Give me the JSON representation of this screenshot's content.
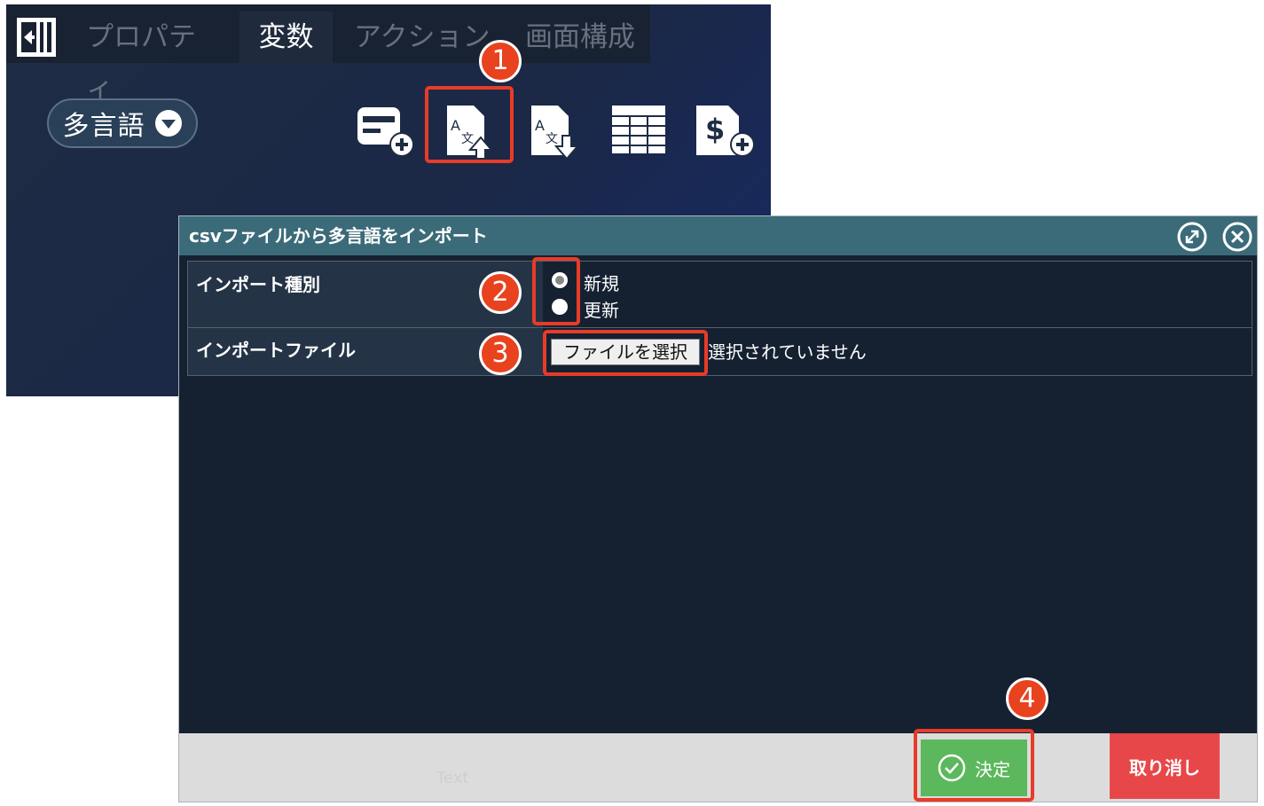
{
  "editor": {
    "tabs": [
      {
        "label": "プロパティ"
      },
      {
        "label": "変数"
      },
      {
        "label": "アクション"
      },
      {
        "label": "画面構成"
      }
    ],
    "language_dropdown_label": "多言語",
    "toolbar_icons": [
      "add-variable-icon",
      "import-language-icon",
      "export-language-icon",
      "table-icon",
      "add-currency-icon"
    ]
  },
  "dialog": {
    "title": "csvファイルから多言語をインポート",
    "import_type": {
      "label": "インポート種別",
      "options": [
        {
          "label": "新規",
          "selected": true
        },
        {
          "label": "更新",
          "selected": false
        }
      ]
    },
    "import_file": {
      "label": "インポートファイル",
      "button_label": "ファイルを選択",
      "status": "選択されていません"
    },
    "confirm_label": "決定",
    "cancel_label": "取り消し",
    "background_text": "Text"
  },
  "annotations": [
    "1",
    "2",
    "3",
    "4"
  ],
  "colors": {
    "title_bar": "#3b6b78",
    "dialog_body": "#152131",
    "confirm": "#5cb85c",
    "cancel": "#e8474a",
    "highlight": "#e83b28"
  }
}
